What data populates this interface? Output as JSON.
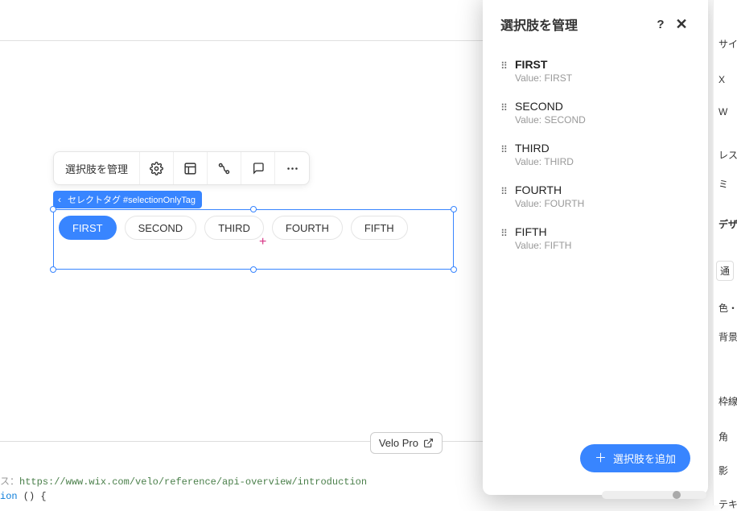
{
  "toolbar": {
    "manage_label": "選択肢を管理"
  },
  "badge": {
    "text": "セレクトタグ #selectionOnlyTag"
  },
  "tags": [
    {
      "label": "FIRST",
      "selected": true
    },
    {
      "label": "SECOND",
      "selected": false
    },
    {
      "label": "THIRD",
      "selected": false
    },
    {
      "label": "FOURTH",
      "selected": false
    },
    {
      "label": "FIFTH",
      "selected": false
    }
  ],
  "popup": {
    "title": "選択肢を管理",
    "value_prefix": "Value: ",
    "options": [
      {
        "label": "FIRST",
        "value": "FIRST",
        "bold": true
      },
      {
        "label": "SECOND",
        "value": "SECOND",
        "bold": false
      },
      {
        "label": "THIRD",
        "value": "THIRD",
        "bold": false
      },
      {
        "label": "FOURTH",
        "value": "FOURTH",
        "bold": false
      },
      {
        "label": "FIFTH",
        "value": "FIFTH",
        "bold": false
      }
    ],
    "add_button": "選択肢を追加"
  },
  "velo": {
    "label": "Velo Pro"
  },
  "code": {
    "prefix": "ス：",
    "url": "https://www.wix.com/velo/reference/api-overview/introduction",
    "line2a": "ion",
    "line2b": " () {"
  },
  "right_strip": {
    "size": "サイ",
    "x": "X",
    "w": "W",
    "res": "レス",
    "mi": "ミ",
    "design": "デザ",
    "normal": "通",
    "color": "色・ス",
    "bg": "背景",
    "border": "枠線",
    "corner": "角",
    "shadow": "影",
    "text": "テキ"
  }
}
